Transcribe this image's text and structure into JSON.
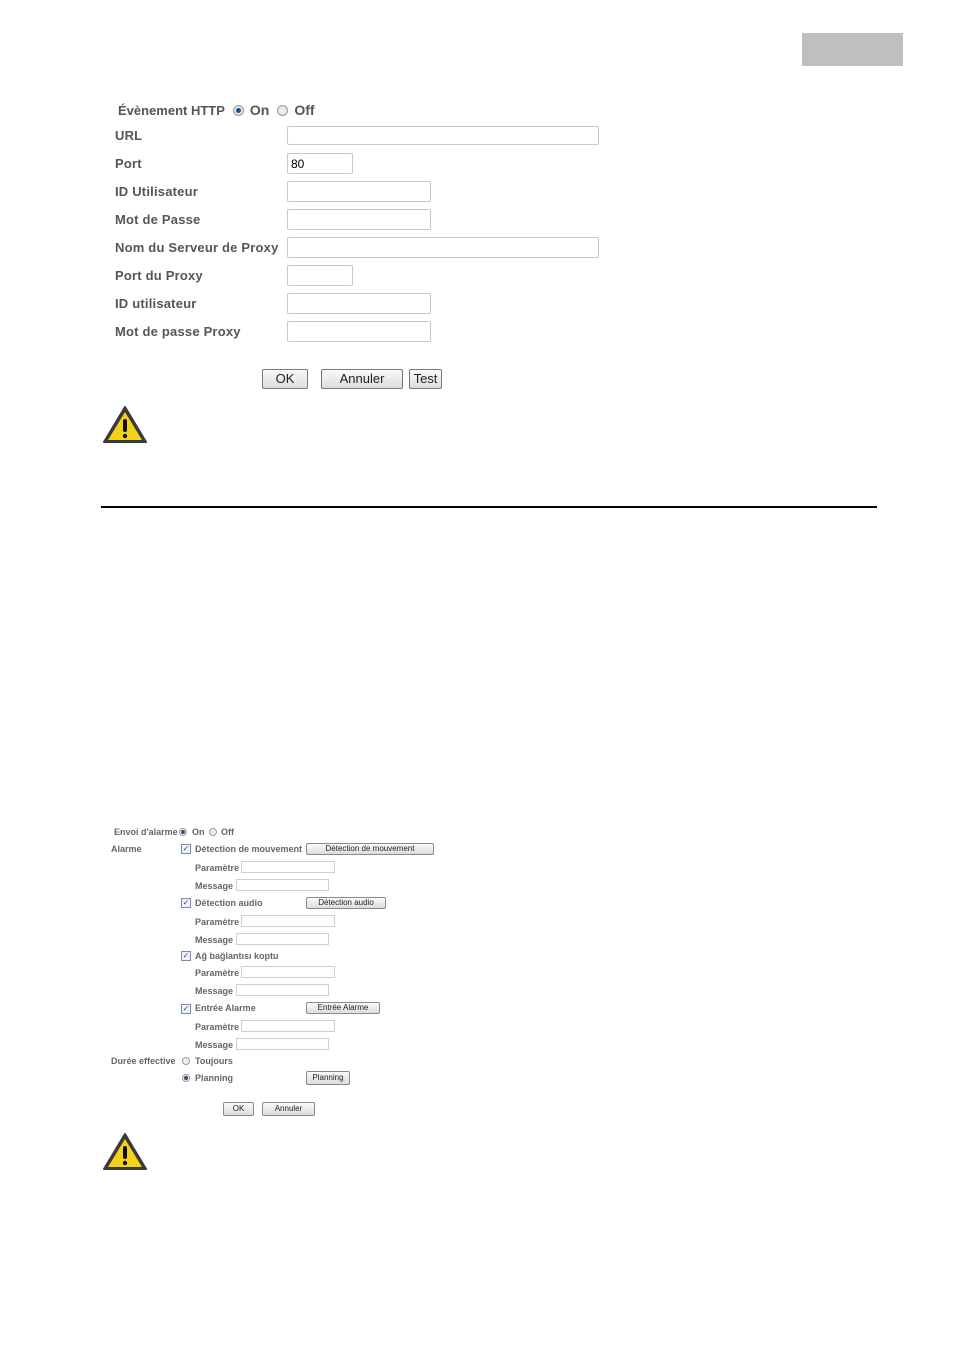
{
  "http_event_form": {
    "title": "Évènement HTTP",
    "mode": {
      "options": [
        "On",
        "Off"
      ],
      "selected": "On"
    },
    "fields": [
      {
        "label": "URL",
        "value": ""
      },
      {
        "label": "Port",
        "value": "80"
      },
      {
        "label": "ID Utilisateur",
        "value": ""
      },
      {
        "label": "Mot de Passe",
        "value": ""
      },
      {
        "label": "Nom du Serveur de Proxy",
        "value": ""
      },
      {
        "label": "Port du Proxy",
        "value": ""
      },
      {
        "label": "ID utilisateur",
        "value": ""
      },
      {
        "label": "Mot de passe Proxy",
        "value": ""
      }
    ],
    "buttons": {
      "ok": "OK",
      "cancel": "Annuler",
      "test": "Test"
    }
  },
  "alarm_form": {
    "send_label": "Envoi d'alarme",
    "send_options": [
      "On",
      "Off"
    ],
    "send_selected": "On",
    "alarm_label": "Alarme",
    "param_label": "Paramètre",
    "message_label": "Message",
    "triggers": [
      {
        "label": "Détection de mouvement",
        "checked": true,
        "button": "Détection de mouvement",
        "parameter": "",
        "message": ""
      },
      {
        "label": "Détection audio",
        "checked": true,
        "button": "Détection audio",
        "parameter": "",
        "message": ""
      },
      {
        "label": "Ağ bağlantısı koptu",
        "checked": true,
        "button": null,
        "parameter": "",
        "message": ""
      },
      {
        "label": "Entrée Alarme",
        "checked": true,
        "button": "Entrée Alarme",
        "parameter": "",
        "message": ""
      }
    ],
    "duration_label": "Durée effective",
    "duration_options": [
      "Toujours",
      "Planning"
    ],
    "duration_selected": "Planning",
    "planning_button": "Planning",
    "buttons": {
      "ok": "OK",
      "cancel": "Annuler"
    }
  },
  "icons": {
    "warning": "warning-triangle-icon"
  },
  "colors": {
    "page_tab": "#c0bfbe",
    "label_text": "#555555",
    "warning_fill": "#f2d21b",
    "rule": "#000000"
  }
}
